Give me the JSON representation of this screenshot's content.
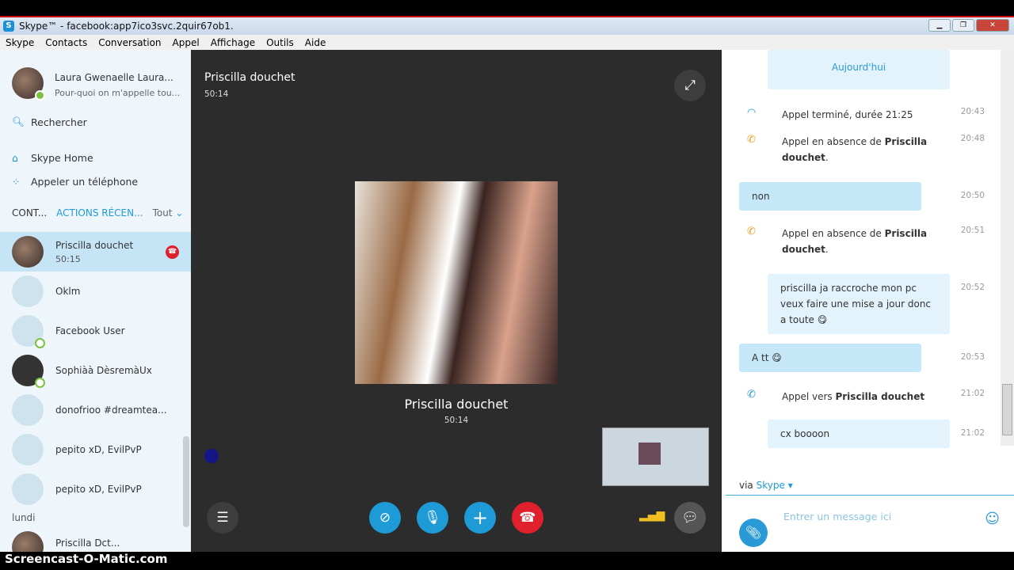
{
  "window": {
    "title": "Skype™ - facebook:app7ico3svc.2quir67ob1."
  },
  "menu": [
    "Skype",
    "Contacts",
    "Conversation",
    "Appel",
    "Affichage",
    "Outils",
    "Aide"
  ],
  "profile": {
    "name": "Laura Gwenaelle Laura...",
    "status": "Pour-quoi on m'appelle tou..."
  },
  "nav": {
    "search": "Rechercher",
    "home": "Skype Home",
    "phone": "Appeler un téléphone"
  },
  "tabs": {
    "contacts": "CONT...",
    "recent": "ACTIONS RÉCEN...",
    "filter": "Tout"
  },
  "contacts": [
    {
      "name": "Priscilla douchet",
      "time": "50:15"
    },
    {
      "name": "Oklm"
    },
    {
      "name": "Facebook User"
    },
    {
      "name": "Sophiàà DèsremàUx"
    },
    {
      "name": "donofrioo #dreamtea..."
    },
    {
      "name": "pepito xD, EvilPvP"
    },
    {
      "name": "pepito xD, EvilPvP"
    }
  ],
  "day_label": "lundi",
  "last_contact": "Priscilla Dct...",
  "call": {
    "name": "Priscilla douchet",
    "duration": "50:14"
  },
  "chat": {
    "date": "Aujourd'hui",
    "events": [
      {
        "text": "Appel terminé, durée 21:25",
        "time": "20:43"
      },
      {
        "pre": "Appel en absence de ",
        "bold": "Priscilla douchet",
        "post": ".",
        "time": "20:48"
      },
      {
        "bubble": "non",
        "time": "20:50"
      },
      {
        "pre": "Appel en absence de ",
        "bold": "Priscilla douchet",
        "post": ".",
        "time": "20:51"
      },
      {
        "bubble": "priscilla ja raccroche mon pc veux faire une mise a jour donc a toute 😋",
        "time": "20:52"
      },
      {
        "bubble": "A tt 😋",
        "time": "20:53"
      },
      {
        "pre": "Appel vers ",
        "bold": "Priscilla douchet",
        "post": "",
        "time": "21:02"
      },
      {
        "bubble": "cx boooon",
        "time": "21:02"
      }
    ],
    "via": "via",
    "via_service": "Skype",
    "placeholder": "Entrer un message ici"
  },
  "colors": {
    "accent": "#1e9ad6",
    "end_call": "#e0202c",
    "missed": "#f39c22"
  },
  "watermark": "Screencast-O-Matic.com"
}
